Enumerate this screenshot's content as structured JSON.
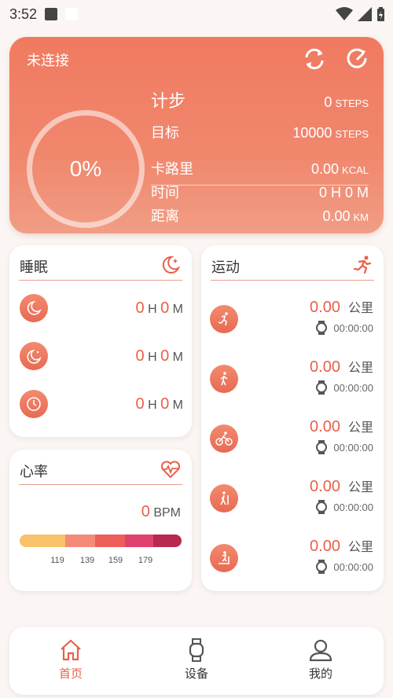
{
  "status": {
    "time": "3:52"
  },
  "hero": {
    "connection": "未连接",
    "progress": "0%",
    "progress_value": 0,
    "steps_label": "计步",
    "steps_value": "0",
    "steps_unit": "STEPS",
    "target_label": "目标",
    "target_value": "10000",
    "target_unit": "STEPS",
    "calorie_label": "卡路里",
    "calorie_value": "0.00",
    "calorie_unit": "KCAL",
    "time_label": "时间",
    "time_value": "0 H 0 M",
    "distance_label": "距离",
    "distance_value": "0.00",
    "distance_unit": "KM"
  },
  "sleep": {
    "title": "睡眠",
    "items": [
      {
        "hours": "0",
        "h": "H",
        "minutes": "0",
        "m": "M"
      },
      {
        "hours": "0",
        "h": "H",
        "minutes": "0",
        "m": "M"
      },
      {
        "hours": "0",
        "h": "H",
        "minutes": "0",
        "m": "M"
      }
    ]
  },
  "heart": {
    "title": "心率",
    "bpm_value": "0",
    "bpm_unit": "BPM",
    "ticks": [
      "119",
      "139",
      "159",
      "179"
    ],
    "zone_colors": [
      "#f7c26a",
      "#f58a78",
      "#ee5e5a",
      "#e0416e",
      "#b8294f"
    ]
  },
  "sport": {
    "title": "运动",
    "items": [
      {
        "icon": "running-icon",
        "distance": "0.00",
        "unit": "公里",
        "duration": "00:00:00"
      },
      {
        "icon": "walking-icon",
        "distance": "0.00",
        "unit": "公里",
        "duration": "00:00:00"
      },
      {
        "icon": "cycling-icon",
        "distance": "0.00",
        "unit": "公里",
        "duration": "00:00:00"
      },
      {
        "icon": "hiking-icon",
        "distance": "0.00",
        "unit": "公里",
        "duration": "00:00:00"
      },
      {
        "icon": "treadmill-icon",
        "distance": "0.00",
        "unit": "公里",
        "duration": "00:00:00"
      }
    ]
  },
  "tabs": [
    {
      "label": "首页",
      "icon": "home-icon",
      "active": true
    },
    {
      "label": "设备",
      "icon": "watch-icon",
      "active": false
    },
    {
      "label": "我的",
      "icon": "user-icon",
      "active": false
    }
  ],
  "colors": {
    "accent": "#e8604a",
    "hero_start": "#f07a60",
    "hero_end": "#f19d85"
  }
}
